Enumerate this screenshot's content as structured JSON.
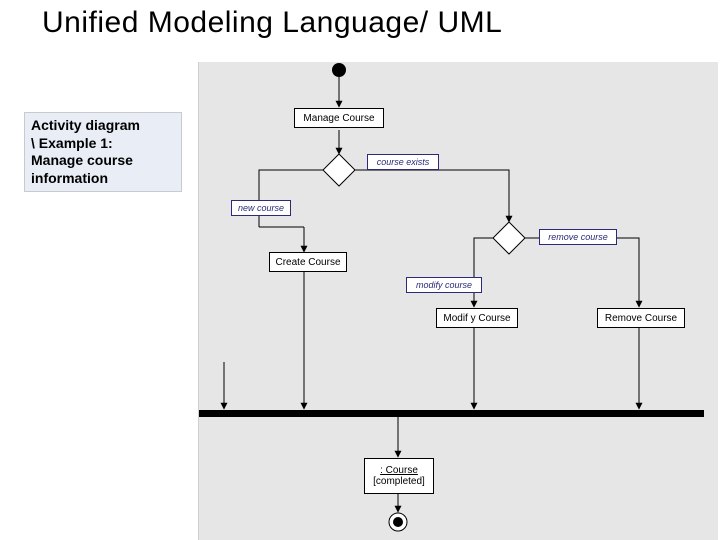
{
  "title": "Unified Modeling Language/ UML",
  "sidebar": {
    "line1": "Activity diagram",
    "line2": "\\ Example 1:",
    "line3": "Manage course",
    "line4": "information"
  },
  "nodes": {
    "manage": "Manage Course",
    "create": "Create Course",
    "modify": "Modif y Course",
    "remove": "Remove Course"
  },
  "guards": {
    "course_exists": "course exists",
    "new_course": "new course",
    "remove_course": "remove course",
    "modify_course": "modify course"
  },
  "object": {
    "name": ": Course",
    "state": "[completed]"
  }
}
